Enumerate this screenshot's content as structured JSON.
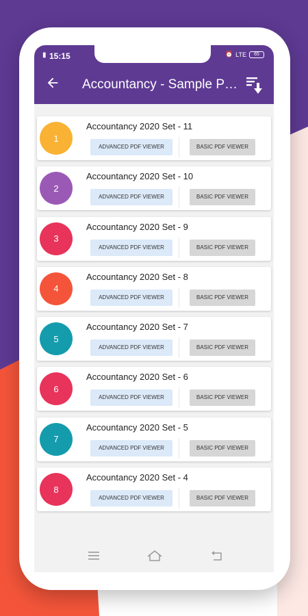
{
  "status_bar": {
    "time": "15:15",
    "network": "LTE",
    "battery": "65"
  },
  "app_bar": {
    "title": "Accountancy - Sample Papers",
    "back_icon": "arrow-back-icon",
    "sort_icon": "sort-download-icon"
  },
  "buttons": {
    "advanced": "ADVANCED PDF VIEWER",
    "basic": "BASIC PDF VIEWER"
  },
  "items": [
    {
      "number": "1",
      "title": "Accountancy 2020 Set - 11",
      "color": "#f9b233"
    },
    {
      "number": "2",
      "title": "Accountancy 2020 Set - 10",
      "color": "#9b59b6"
    },
    {
      "number": "3",
      "title": "Accountancy 2020 Set - 9",
      "color": "#e8335b"
    },
    {
      "number": "4",
      "title": "Accountancy 2020 Set - 8",
      "color": "#f4553a"
    },
    {
      "number": "5",
      "title": "Accountancy 2020 Set - 7",
      "color": "#149cad"
    },
    {
      "number": "6",
      "title": "Accountancy 2020 Set - 6",
      "color": "#e8335b"
    },
    {
      "number": "7",
      "title": "Accountancy 2020 Set - 5",
      "color": "#149cad"
    },
    {
      "number": "8",
      "title": "Accountancy 2020 Set - 4",
      "color": "#e8335b"
    }
  ],
  "nav_bar": {
    "menu_icon": "menu-icon",
    "home_icon": "home-icon",
    "back_icon": "back-icon"
  },
  "colors": {
    "primary": "#5e3a93",
    "accent_orange": "#f4553a",
    "advanced_btn_bg": "#dbe9f8",
    "basic_btn_bg": "#d6d6d6"
  }
}
